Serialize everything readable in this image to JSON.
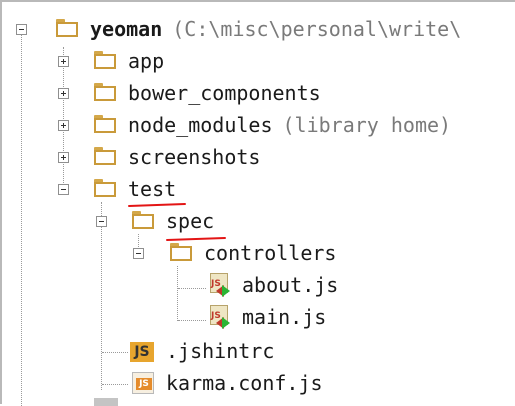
{
  "tree": {
    "root": {
      "name": "yeoman",
      "path": "(C:\\misc\\personal\\write\\"
    },
    "items": [
      {
        "name": "app"
      },
      {
        "name": "bower_components"
      },
      {
        "name": "node_modules",
        "note": "(library home)"
      },
      {
        "name": "screenshots"
      },
      {
        "name": "test"
      },
      {
        "name": "spec"
      },
      {
        "name": "controllers"
      },
      {
        "name": "about.js"
      },
      {
        "name": "main.js"
      },
      {
        "name": ".jshintrc",
        "icon_text": "JS"
      },
      {
        "name": "karma.conf.js",
        "icon_text": "JS"
      }
    ]
  },
  "icons": {
    "folder": "folder-icon",
    "js_test": "js-test-file-icon",
    "jshint": "jshint-icon",
    "karma": "karma-config-icon"
  },
  "colors": {
    "annotation_underline": "#e31515",
    "folder": "#c99a3a"
  }
}
